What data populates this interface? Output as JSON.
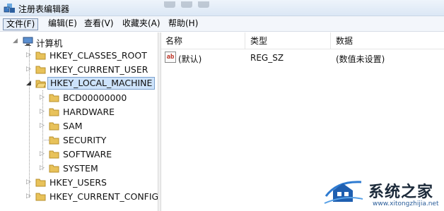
{
  "window": {
    "title": "注册表编辑器"
  },
  "menu": {
    "items": [
      {
        "label": "文件(F)"
      },
      {
        "label": "编辑(E)"
      },
      {
        "label": "查看(V)"
      },
      {
        "label": "收藏夹(A)"
      },
      {
        "label": "帮助(H)"
      }
    ]
  },
  "tree": {
    "root": {
      "label": "计算机",
      "icon": "computer-icon"
    },
    "hives": [
      {
        "label": "HKEY_CLASSES_ROOT",
        "expanded": false
      },
      {
        "label": "HKEY_CURRENT_USER",
        "expanded": false
      },
      {
        "label": "HKEY_LOCAL_MACHINE",
        "expanded": true,
        "selected": true
      },
      {
        "label": "HKEY_USERS",
        "expanded": false
      },
      {
        "label": "HKEY_CURRENT_CONFIG",
        "expanded": false
      }
    ],
    "local_machine_children": [
      {
        "label": "BCD00000000"
      },
      {
        "label": "HARDWARE"
      },
      {
        "label": "SAM"
      },
      {
        "label": "SECURITY"
      },
      {
        "label": "SOFTWARE"
      },
      {
        "label": "SYSTEM"
      }
    ]
  },
  "list": {
    "columns": [
      {
        "label": "名称"
      },
      {
        "label": "类型"
      },
      {
        "label": "数据"
      }
    ],
    "rows": [
      {
        "name": "(默认)",
        "type": "REG_SZ",
        "data": "(数值未设置)",
        "icon": "string-value-icon"
      }
    ]
  },
  "watermark": {
    "text": "系统之家",
    "url": "www.xitongzhijia.net"
  },
  "colors": {
    "selection_bg": "#cde3fb",
    "selection_border": "#7da2ce",
    "folder": "#e8c25a"
  }
}
